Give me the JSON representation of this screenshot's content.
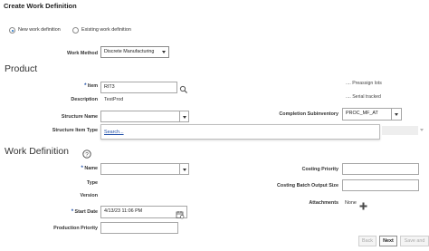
{
  "page": {
    "title": "Create Work Definition"
  },
  "definition_type": {
    "options": [
      "New work definition",
      "Existing work definition"
    ],
    "selected": "New work definition"
  },
  "work_method": {
    "label": "Work Method",
    "value": "Discrete Manufacturing"
  },
  "product": {
    "heading": "Product",
    "item": {
      "label": "Item",
      "value": "RIT3"
    },
    "description": {
      "label": "Description",
      "value": "TestProd"
    },
    "structure_name": {
      "label": "Structure Name",
      "value": ""
    },
    "structure_item_type": {
      "label": "Structure Item Type",
      "dropdown_link": "Search..."
    },
    "preassign_lots": {
      "label": "Preassign lots",
      "value": "...."
    },
    "serial_tracked": {
      "label": "Serial tracked",
      "value": "...."
    },
    "completion_subinventory": {
      "label": "Completion Subinventory",
      "value": "PROC_MF_AT"
    }
  },
  "work_definition": {
    "heading": "Work Definition",
    "help_icon": "help-icon",
    "name": {
      "label": "Name",
      "value": ""
    },
    "type": {
      "label": "Type",
      "value": ""
    },
    "version": {
      "label": "Version",
      "value": ""
    },
    "start_date": {
      "label": "Start Date",
      "value": "4/13/23 11:06 PM"
    },
    "production_priority": {
      "label": "Production Priority",
      "value": ""
    },
    "costing_priority": {
      "label": "Costing Priority",
      "value": ""
    },
    "costing_batch_output_size": {
      "label": "Costing Batch Output Size",
      "value": ""
    },
    "attachments": {
      "label": "Attachments",
      "value": "None"
    }
  },
  "footer": {
    "back": "Back",
    "next": "Next",
    "save_and": "Save and"
  },
  "colors": {
    "link": "#1f4ea8",
    "required": "#1f4ea8"
  }
}
